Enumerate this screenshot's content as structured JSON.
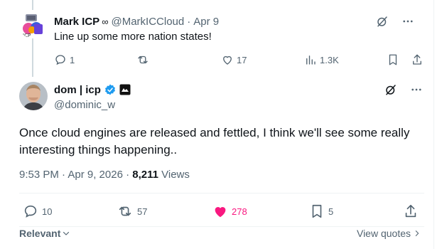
{
  "reply": {
    "name": "Mark ICP",
    "infinity": "∞",
    "handle": "@MarkICCloud",
    "date": "Apr 9",
    "text": "Line up some more nation states!",
    "replies": "1",
    "likes": "17",
    "views": "1.3K"
  },
  "main": {
    "name": "dom | icp",
    "handle": "@dominic_w",
    "text": "Once cloud engines are released and fettled, I think we'll see some really interesting things happening..",
    "time": "9:53 PM · Apr 9, 2026 · ",
    "views_count": "8,211",
    "views_label": " Views",
    "replies": "10",
    "reposts": "57",
    "likes": "278",
    "bookmarks": "5"
  },
  "footer": {
    "relevant": "Relevant",
    "view_quotes": "View quotes"
  },
  "colors": {
    "text": "#0f1419",
    "muted": "#536471",
    "like": "#f91880",
    "verified": "#1d9bf0",
    "border": "#eff3f4"
  }
}
